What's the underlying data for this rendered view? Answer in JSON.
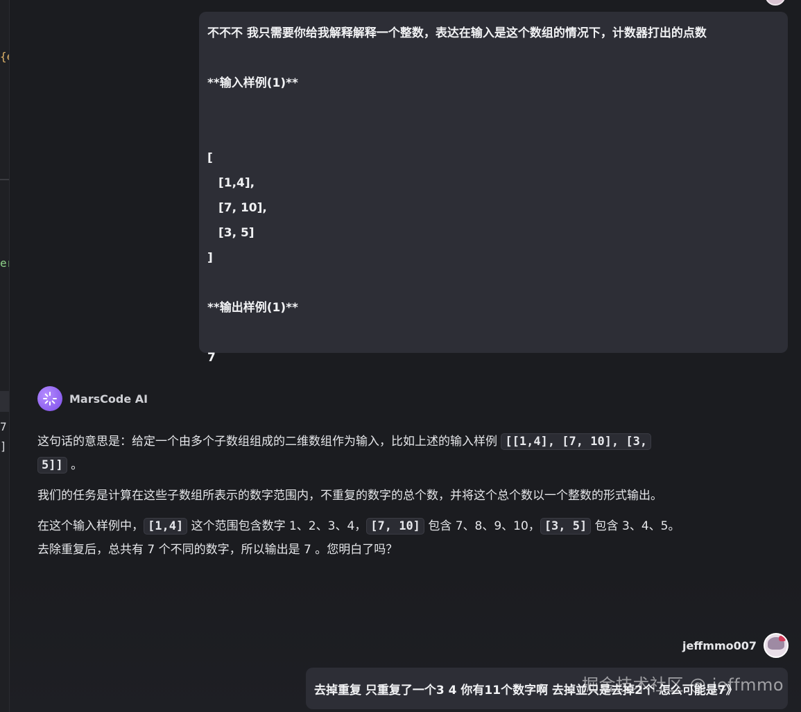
{
  "editor_fragments": [
    {
      "text": "{e",
      "color": "#e0b36a"
    },
    {
      "text": "er",
      "color": "#8fd48a"
    },
    {
      "text": "7",
      "color": "#dcdde1"
    },
    {
      "text": "]:",
      "color": "#dcdde1"
    }
  ],
  "user_message_1": {
    "lines": [
      "不不不 我只需要你给我解释解释一个整数，表达在输入是这个数组的情况下，计数器打出的点数",
      "",
      "**输入样例(1)**",
      "",
      "",
      "[",
      "[1,4],",
      "[7, 10],",
      "[3, 5]",
      "]",
      "",
      "**输出样例(1)**",
      "",
      "7"
    ]
  },
  "ai": {
    "name": "MarsCode AI",
    "p1_prefix": "这句话的意思是：给定一个由多个子数组组成的二维数组作为输入，比如上述的输入样例 ",
    "p1_code_a": "[[1,4], [7, 10], [3,",
    "p1_code_b": "5]]",
    "p1_suffix": " 。",
    "p2": "我们的任务是计算在这些子数组所表示的数字范围内，不重复的数字的总个数，并将这个总个数以一个整数的形式输出。",
    "p3_a": "在这个输入样例中，",
    "p3_code1": "[1,4]",
    "p3_b": " 这个范围包含数字 1、2、3、4，",
    "p3_code2": "[7, 10]",
    "p3_c": " 包含 7、8、9、10，",
    "p3_code3": "[3, 5]",
    "p3_d": " 包含 3、4、5。",
    "p3_e": "去除重复后，总共有 7 个不同的数字，所以输出是 7 。您明白了吗？"
  },
  "user2": {
    "name": "jeffmmo007",
    "message": "去掉重复 只重复了一个3 4 你有11个数字啊 去掉並只是去掉2个 怎么可能是7》"
  },
  "watermark": "掘金技术社区 @ jeffmmo"
}
